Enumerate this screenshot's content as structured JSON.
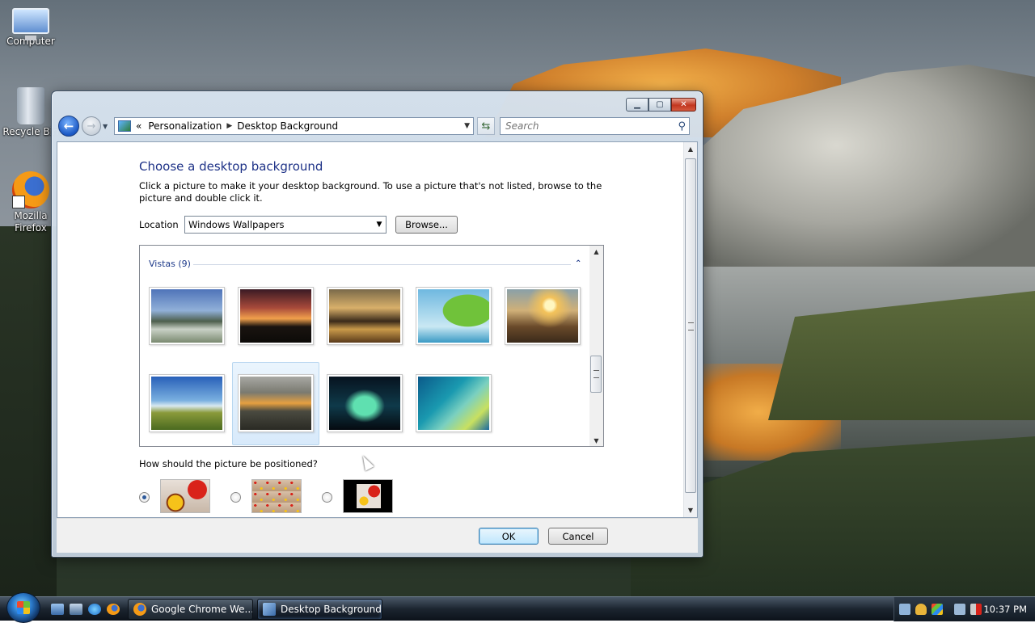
{
  "desktop": {
    "icons": [
      {
        "label": "Computer",
        "icon": "computer-icon"
      },
      {
        "label": "Recycle Bin",
        "icon": "recycle-bin-icon"
      },
      {
        "label": "Mozilla Firefox",
        "icon": "firefox-icon"
      }
    ]
  },
  "window": {
    "title": "Desktop Background",
    "caption": {
      "minimize": "▁",
      "maximize": "▢",
      "close": "✕"
    },
    "breadcrumb": {
      "prefix": "«",
      "items": [
        "Personalization",
        "Desktop Background"
      ]
    },
    "search": {
      "placeholder": "Search"
    },
    "heading": "Choose a desktop background",
    "description": "Click a picture to make it your desktop background. To use a picture that's not listed, browse to the picture and double click it.",
    "location": {
      "label": "Location",
      "value": "Windows Wallpapers",
      "browse": "Browse..."
    },
    "gallery": {
      "group_title": "Vistas (9)",
      "selected_index": 6,
      "wallpapers": [
        "vista-1",
        "vista-2",
        "vista-3",
        "vista-4",
        "vista-5",
        "vista-6",
        "vista-7",
        "vista-8",
        "vista-9"
      ]
    },
    "position": {
      "label": "How should the picture be positioned?",
      "options": [
        "fill",
        "tile",
        "center"
      ],
      "selected": "fill"
    },
    "buttons": {
      "ok": "OK",
      "cancel": "Cancel"
    }
  },
  "taskbar": {
    "tasks": [
      {
        "label": "Google Chrome We...",
        "active": false
      },
      {
        "label": "Desktop Background",
        "active": true
      }
    ],
    "clock": "10:37 PM"
  },
  "colors": {
    "heading_blue": "#1e3287",
    "link_blue": "#1e3a8a",
    "selection_blue": "#d8eafb"
  }
}
